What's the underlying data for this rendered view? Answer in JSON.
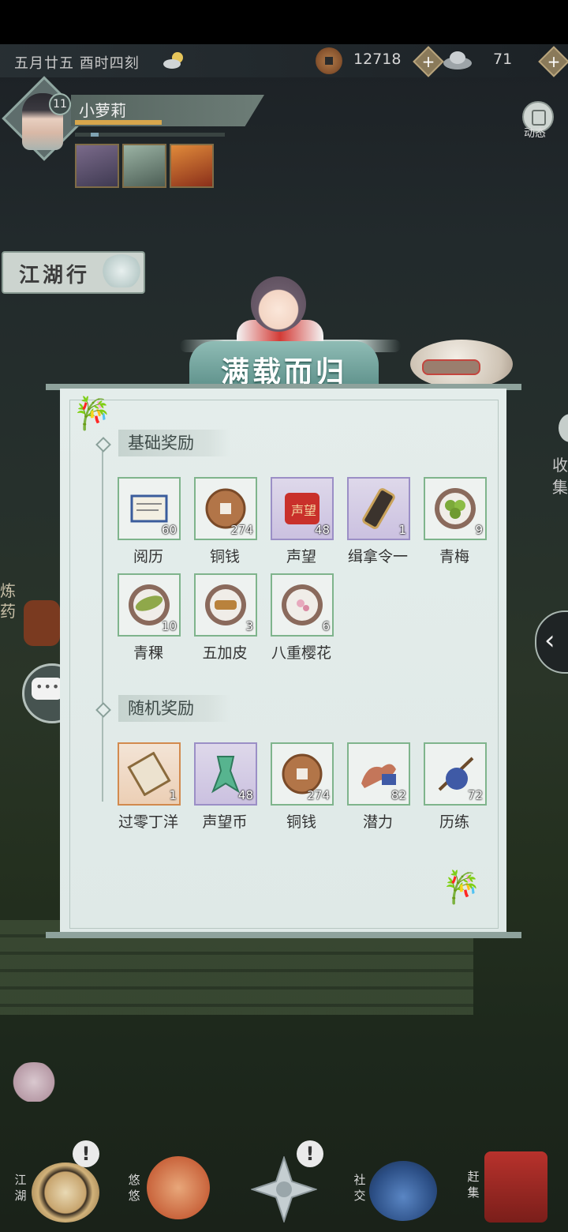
{
  "topbar": {
    "date": "五月廿五  酉时四刻",
    "weather_icon": "sun-cloud-icon",
    "coins": "12718",
    "silver": "71"
  },
  "player": {
    "level": "11",
    "name": "小萝莉",
    "dynamic_label": "动态"
  },
  "jianghu_label": "江湖行",
  "side_right_text": "收集",
  "side_left_text": "炼药",
  "reward_title": "满载而归",
  "basic": {
    "title": "基础奖励",
    "items": [
      {
        "name": "阅历",
        "count": "60",
        "icon": "scroll-icon",
        "rarity": "green"
      },
      {
        "name": "铜钱",
        "count": "274",
        "icon": "copper-coin-icon",
        "rarity": "green"
      },
      {
        "name": "声望",
        "count": "48",
        "icon": "reputation-banner-icon",
        "rarity": "purple"
      },
      {
        "name": "缉拿令一",
        "count": "1",
        "icon": "arrest-token-icon",
        "rarity": "purple"
      },
      {
        "name": "青梅",
        "count": "9",
        "icon": "green-plum-icon",
        "rarity": "green"
      },
      {
        "name": "青稞",
        "count": "10",
        "icon": "barley-icon",
        "rarity": "green"
      },
      {
        "name": "五加皮",
        "count": "3",
        "icon": "bark-herb-icon",
        "rarity": "green"
      },
      {
        "name": "八重樱花",
        "count": "6",
        "icon": "cherry-blossom-icon",
        "rarity": "green"
      }
    ]
  },
  "random": {
    "title": "随机奖励",
    "items": [
      {
        "name": "过零丁洋",
        "count": "1",
        "icon": "poem-scroll-icon",
        "rarity": "orange"
      },
      {
        "name": "声望币",
        "count": "48",
        "icon": "jade-coin-icon",
        "rarity": "purple"
      },
      {
        "name": "铜钱",
        "count": "274",
        "icon": "copper-coin-icon",
        "rarity": "green"
      },
      {
        "name": "潜力",
        "count": "82",
        "icon": "muscle-arm-icon",
        "rarity": "green"
      },
      {
        "name": "历练",
        "count": "72",
        "icon": "bundle-stick-icon",
        "rarity": "green"
      }
    ]
  },
  "bottom_nav": [
    {
      "label": "江湖",
      "icon": "straw-hat-icon"
    },
    {
      "label": "悠悠",
      "icon": "crane-icon"
    },
    {
      "label": "",
      "icon": "compass-star-icon"
    },
    {
      "label": "社交",
      "icon": "wave-icon"
    },
    {
      "label": "赶集",
      "icon": "basket-icon"
    }
  ],
  "colors": {
    "panel": "#e4edeb",
    "title_plate": "#5c8f89",
    "green_border": "#7fb48c",
    "purple_border": "#9b8fc6",
    "orange_border": "#d28a4e"
  }
}
